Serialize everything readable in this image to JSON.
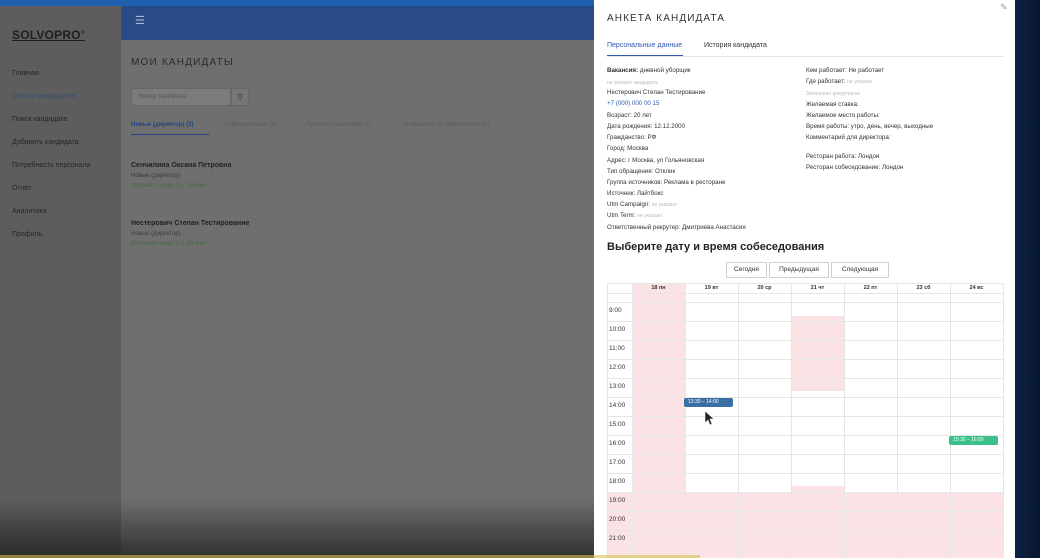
{
  "app": {
    "logo": "SOLVOPRO",
    "logo_reg": "®"
  },
  "sidebar": {
    "items": [
      {
        "label": "Главная",
        "active": false
      },
      {
        "label": "Список кандидатов",
        "active": true
      },
      {
        "label": "Поиск кандидата",
        "active": false
      },
      {
        "label": "Добавить кандидата",
        "active": false
      },
      {
        "label": "Потребность персонала",
        "active": false
      },
      {
        "label": "Отчёт",
        "active": false
      },
      {
        "label": "Аналитика",
        "active": false
      },
      {
        "label": "Профиль",
        "active": false
      }
    ]
  },
  "main": {
    "title": "МОИ КАНДИДАТЫ",
    "search_placeholder": "Номер телефона",
    "tabs": [
      {
        "label": "Новые (директор) (2)"
      },
      {
        "label": "Собеседование (3)"
      },
      {
        "label": "Прошел стажировку (1)"
      },
      {
        "label": "Отправлен на оформление (1)"
      }
    ],
    "candidates": [
      {
        "name": "Сенчилина Оксана Петровна",
        "status": "Новые (директор)",
        "expires": "Истекает через 3 ч. 59 мин."
      },
      {
        "name": "Нестерович Степан Тестирование",
        "status": "Новые (директор)",
        "expires": "Истекает через 3 ч. 59 мин."
      }
    ]
  },
  "panel": {
    "title": "АНКЕТА КАНДИДАТА",
    "tabs": [
      {
        "label": "Персональные данные",
        "active": true
      },
      {
        "label": "История кандидата",
        "active": false
      }
    ],
    "left": {
      "vacancy_label": "Вакансия:",
      "vacancy_value": "дневной уборщик",
      "not_specified_1": "не указано кандидата",
      "full_name": "Нестерович Степан Тестирование",
      "phone": "+7 (000) 000 00 15",
      "age": "Возраст: 20 лет",
      "birth_date": "Дата рождения: 12.12.2000",
      "citizenship": "Гражданство: РФ",
      "city": "Город: Москва",
      "address": "Адрес: г Москва, ул Гольяновская",
      "request_type": "Тип обращения: Отклик",
      "source_group": "Группа источников: Реклама в ресторане",
      "source": "Источник: Лайтбокс",
      "utm_campaign_label": "Utm Campaign:",
      "utm_campaign_value": "не указано",
      "utm_term_label": "Utm Term:",
      "utm_term_value": "не указано",
      "recruiter": "Ответственный рекрутер: Дмитриева Анастасия"
    },
    "right": {
      "works_as": "Кем работает: Не работает",
      "works_where_label": "Где работает:",
      "works_where_value": "не указано",
      "recruiter_note": "Заполнено рекрутером",
      "desired_rate": "Желаемая ставка:",
      "desired_place": "Желаемое место работы:",
      "work_time": "Время работы: утро, день, вечер, выходные",
      "director_comment": "Комментарий для директора:",
      "restaurant_work": "Ресторан работа: Лондон",
      "restaurant_interview": "Ресторан собеседование: Лондон"
    },
    "schedule_title": "Выберите дату и время собеседования",
    "nav_buttons": {
      "today": "Сегодня",
      "prev": "Предыдущая",
      "next": "Следующая"
    }
  },
  "calendar": {
    "days": [
      "18 пн",
      "19 вт",
      "20 ср",
      "21 чт",
      "22 пт",
      "23 сб",
      "24 вс"
    ],
    "times": [
      "9:00",
      "10:00",
      "11:00",
      "12:00",
      "13:00",
      "14:00",
      "15:00",
      "16:00",
      "17:00",
      "18:00",
      "19:00",
      "20:00",
      "21:00"
    ],
    "events": [
      {
        "day": 1,
        "label": "13:30 – 14:00",
        "color": "#3a6ea5"
      },
      {
        "day": 6,
        "label": "15:30 – 16:00",
        "color": "#3cc089"
      }
    ]
  }
}
